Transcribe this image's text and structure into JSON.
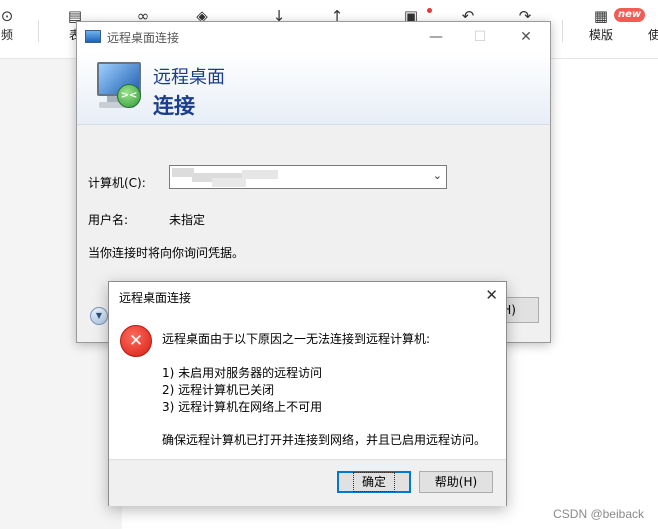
{
  "editor": {
    "toolbar": {
      "items": [
        {
          "label": "频",
          "icon": "video-icon"
        },
        {
          "label": "表",
          "icon": "table-icon"
        },
        {
          "label": "",
          "icon": "link-icon"
        },
        {
          "label": "",
          "icon": "tag-icon"
        },
        {
          "label": "",
          "icon": "download-icon"
        },
        {
          "label": "",
          "icon": "upload-icon"
        },
        {
          "label": "",
          "icon": "save-icon"
        },
        {
          "label": "",
          "icon": "undo-icon"
        },
        {
          "label": "",
          "icon": "redo-icon"
        },
        {
          "label": "模版",
          "icon": "template-icon"
        },
        {
          "label": "使",
          "icon": "use-icon"
        }
      ],
      "new_badge": "new"
    },
    "watermark": "CSDN @beiback"
  },
  "rdp_window": {
    "title": "远程桌面连接",
    "banner_line1": "远程桌面",
    "banner_line2": "连接",
    "computer_label": "计算机(C):",
    "computer_value": "",
    "username_label": "用户名:",
    "username_value": "未指定",
    "prompt_text": "当你连接时将向你询问凭据。",
    "hidden_button_fragment": "H)"
  },
  "error_dialog": {
    "title": "远程桌面连接",
    "message": "远程桌面由于以下原因之一无法连接到远程计算机:",
    "reasons": [
      "1) 未启用对服务器的远程访问",
      "2) 远程计算机已关闭",
      "3) 远程计算机在网络上不可用"
    ],
    "hint": "确保远程计算机已打开并连接到网络，并且已启用远程访问。",
    "ok_button": "确定",
    "help_button": "帮助(H)"
  },
  "colors": {
    "banner_text": "#1a3e8c",
    "error_icon": "#d61f12",
    "focus_border": "#0078d7",
    "new_badge": "#f25c54"
  }
}
